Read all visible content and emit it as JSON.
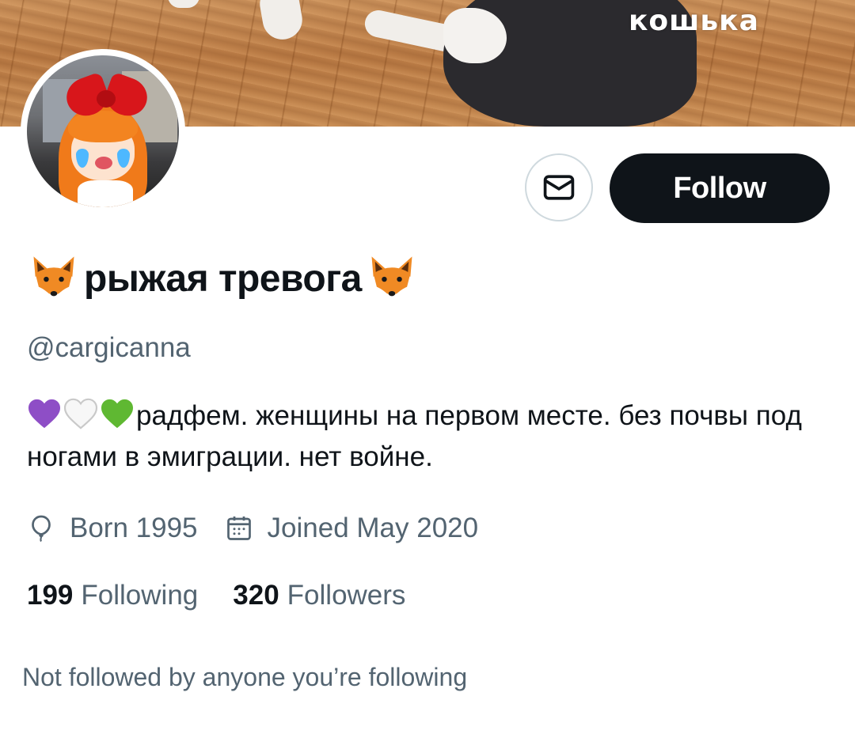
{
  "banner": {
    "caption": "кошька"
  },
  "header": {
    "message_icon": "envelope-icon",
    "follow_label": "Follow"
  },
  "profile": {
    "display_name": "рыжая тревога",
    "name_emoji": "fox-emoji",
    "handle": "@cargicanna",
    "bio_emojis": [
      "purple-heart",
      "white-heart",
      "green-heart"
    ],
    "bio": "радфем. женщины на первом месте. без почвы под ногами в эмиграции. нет войне.",
    "born": "Born 1995",
    "joined": "Joined May 2020",
    "following_count": "199",
    "following_label": "Following",
    "followers_count": "320",
    "followers_label": "Followers",
    "followed_by_note": "Not followed by anyone you’re following"
  },
  "colors": {
    "text": "#0f1419",
    "secondary": "#536471",
    "button": "#0f1419",
    "border": "#cfd9de",
    "purple_heart": "#8e4ec6",
    "green_heart": "#5fb832",
    "fox_orange": "#f08a24"
  }
}
